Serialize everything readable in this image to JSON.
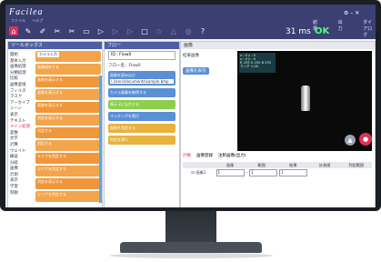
{
  "app": {
    "logo": "Facilea",
    "menu": [
      "ファイル",
      "ヘルプ"
    ]
  },
  "toolbar": {
    "time": "31 ms",
    "status": "OK",
    "labels": [
      "結果",
      "出力",
      "ダイアログ"
    ]
  },
  "left_panel": {
    "header": "ツールボックス",
    "categories": [
      "開始",
      "基本入力",
      "画像処理",
      "分類処理",
      "比較",
      "画像変換",
      "フィルタ",
      "マスク",
      "アーカイブ",
      "シーン",
      "表示",
      "テキスト",
      "メイン処理",
      "変数",
      "文字",
      "計算",
      "ウェイト",
      "繰返",
      "分岐",
      "画像",
      "計測",
      "表示",
      "学習",
      "制御",
      "判定",
      "画像",
      "音声",
      "外部"
    ],
    "active_category": "メイン処理",
    "blocks": [
      "カメラ入力",
      "画像保存する",
      "画像を表示する",
      "画像を表示する",
      "画像を表示する",
      "判定を表示する",
      "判定する",
      "判定する",
      "エリアを判定する",
      "エリアを判定する",
      "判定を表示する",
      "エリアを判定する",
      "画像",
      "判定",
      "判定する",
      "判定を表示する"
    ]
  },
  "middle_panel": {
    "header": "フロー",
    "field_label": "ID : Flow0",
    "flow_label": "フロー名：Flow0",
    "blocks": [
      "画像を読み込む",
      "\\ Users\\documents\\sample.bmp",
      "カメラ画像を取得する",
      "表示 2に出力する",
      "マッチングを実行",
      "画像を判定する",
      "判定を実行"
    ]
  },
  "right_panel": {
    "header": "画像",
    "left_label": "結果画像",
    "chip": "画像を表示",
    "overlay": [
      "x : 0 y : 0",
      "x : 0 y : 0",
      "R 255 G 255 B 255",
      "マッチ 1.00"
    ],
    "tabs": [
      "計数",
      "画像登録",
      "注釈画像(出力)"
    ],
    "table_headers": [
      "",
      "画像",
      "範囲",
      "結果",
      "計測値",
      "判定範囲"
    ],
    "row": {
      "name": "画像1",
      "c1": "1",
      "c2": "1",
      "c3": "1"
    }
  }
}
